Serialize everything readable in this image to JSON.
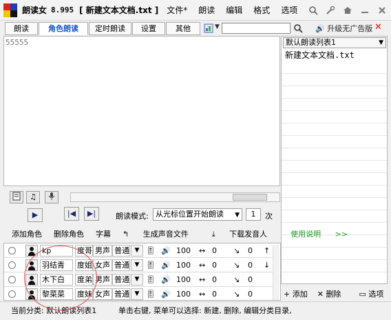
{
  "titlebar": {
    "app_name": "朗读女",
    "version": "8.995",
    "doc_title": "[ 新建文本文档.txt ]"
  },
  "menu": [
    "文件*",
    "朗读",
    "编辑",
    "格式",
    "选项"
  ],
  "tabs": [
    "朗读",
    "角色朗读",
    "定时朗读",
    "设置",
    "其他"
  ],
  "search": {
    "placeholder": ""
  },
  "upgrade_label": "升级无广告版",
  "close_label": "✕",
  "editor": {
    "text": "55555"
  },
  "playlist": {
    "selected": "默认朗读列表1",
    "items": [
      "新建文本文档.txt"
    ]
  },
  "playbar": {
    "mode_label": "朗读模式:",
    "mode_value": "从光标位置开始朗读",
    "count": "1",
    "times_label": "次"
  },
  "actions": [
    "添加角色",
    "删除角色",
    "字幕",
    "生成声音文件",
    "下载发音人",
    "使用说明"
  ],
  "roles": [
    {
      "name": "kp",
      "voice": "度哥",
      "gender": "男声",
      "quality": "普通i",
      "volume": "100",
      "speed": "0",
      "pitch": "0"
    },
    {
      "name": "羽结青",
      "voice": "度姐",
      "gender": "女声",
      "quality": "普通i",
      "volume": "100",
      "speed": "0",
      "pitch": "0"
    },
    {
      "name": "木下白",
      "voice": "度弟",
      "gender": "男声",
      "quality": "普通i",
      "volume": "100",
      "speed": "0",
      "pitch": "0"
    },
    {
      "name": "黎菜菜",
      "voice": "度妹",
      "gender": "女声",
      "quality": "普通i",
      "volume": "100",
      "speed": "0",
      "pitch": "0"
    }
  ],
  "playlist_buttons": [
    "添加",
    "删除",
    "选项"
  ],
  "status": {
    "current": "当前分类: 默认朗读列表1",
    "hint": "单击右键, 菜单可以选择: 新建, 删除, 编辑分类目录,"
  },
  "colors": {
    "accent": "#1a57c8",
    "help": "#1a9a1a",
    "close": "#d01010"
  }
}
